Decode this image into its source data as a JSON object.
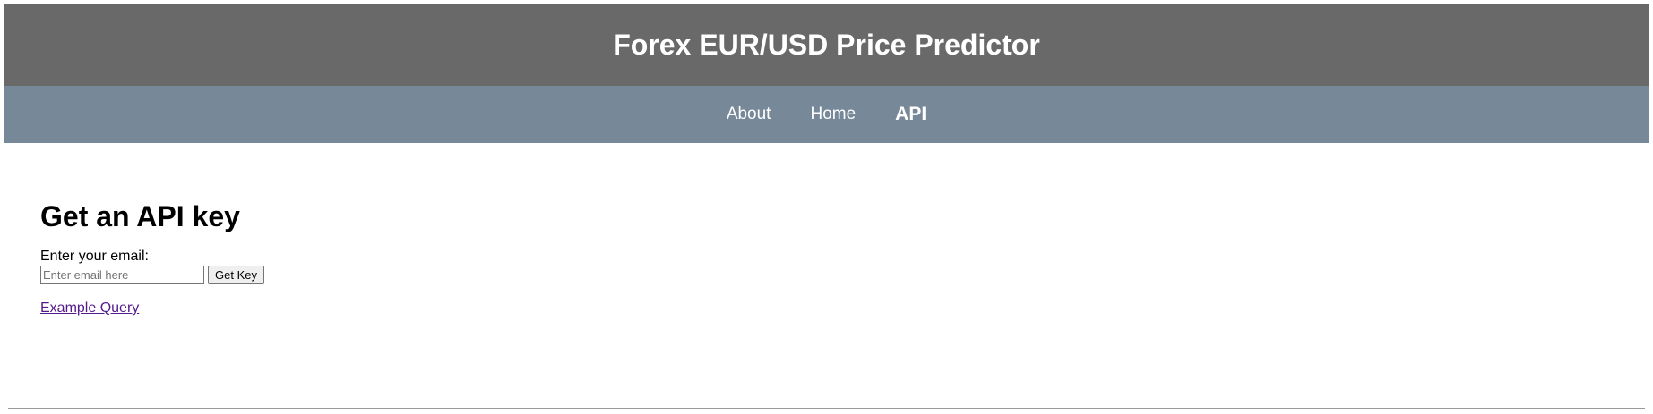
{
  "header": {
    "title": "Forex EUR/USD Price Predictor"
  },
  "nav": {
    "items": [
      {
        "label": "About"
      },
      {
        "label": "Home"
      },
      {
        "label": "API"
      }
    ],
    "active": "API"
  },
  "main": {
    "heading": "Get an API key",
    "email_label": "Enter your email:",
    "email_placeholder": "Enter email here",
    "email_value": "",
    "submit_label": "Get Key",
    "example_link": "Example Query"
  },
  "colors": {
    "header_bg": "#696969",
    "nav_bg": "#778899",
    "visited_link": "#551a8b"
  }
}
